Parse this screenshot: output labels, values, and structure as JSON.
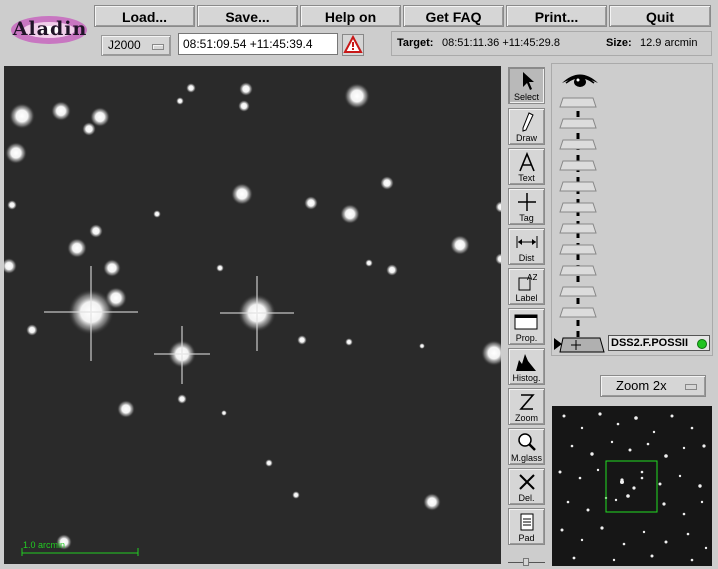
{
  "app": {
    "logo_text": "Aladin"
  },
  "menu": [
    {
      "label": "Load..."
    },
    {
      "label": "Save..."
    },
    {
      "label": "Help on"
    },
    {
      "label": "Get FAQ"
    },
    {
      "label": "Print..."
    },
    {
      "label": "Quit"
    }
  ],
  "frame_select": {
    "value": "J2000"
  },
  "position": {
    "value": "08:51:09.54 +11:45:39.4"
  },
  "info": {
    "target_label": "Target:",
    "target_value": "08:51:11.36 +11:45:29.8",
    "size_label": "Size:",
    "size_value": "12.9 arcmin"
  },
  "tools": [
    {
      "label": "Select"
    },
    {
      "label": "Draw"
    },
    {
      "label": "Text"
    },
    {
      "label": "Tag"
    },
    {
      "label": "Dist"
    },
    {
      "label": "Label"
    },
    {
      "label": "Prop."
    },
    {
      "label": "Histog."
    },
    {
      "label": "Zoom"
    },
    {
      "label": "M.glass"
    },
    {
      "label": "Del."
    },
    {
      "label": "Pad"
    }
  ],
  "plane": {
    "name": "DSS2.F.POSSII",
    "status_color": "#22c422"
  },
  "zoom": {
    "value": "Zoom 2x"
  },
  "scale": {
    "label": "1.0 arcmin"
  },
  "colors": {
    "scale_bar": "#22cc22",
    "panner_box": "#22dd22",
    "plane_label_bg": "#e6e6e6"
  }
}
